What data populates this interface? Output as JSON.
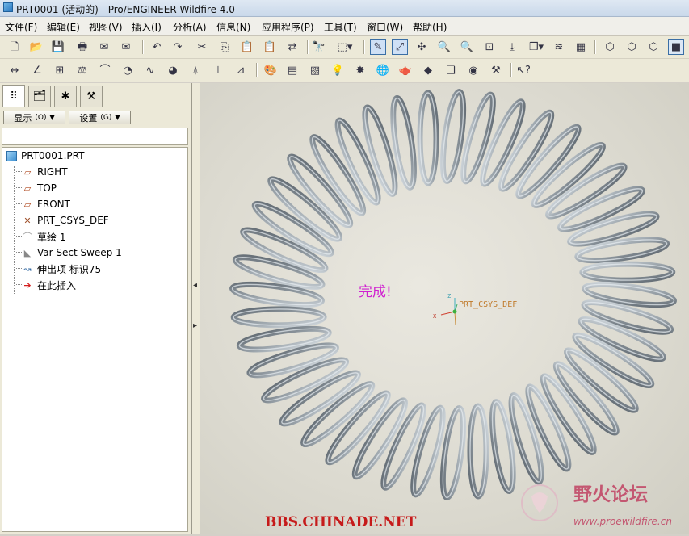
{
  "window": {
    "title": "PRT0001 (活动的) - Pro/ENGINEER Wildfire 4.0"
  },
  "menu": [
    "文件(F)",
    "编辑(E)",
    "视图(V)",
    "插入(I)",
    "分析(A)",
    "信息(N)",
    "应用程序(P)",
    "工具(T)",
    "窗口(W)",
    "帮助(H)"
  ],
  "panel": {
    "show_label": "显示",
    "show_key": "(O)",
    "settings_label": "设置",
    "settings_key": "(G)"
  },
  "tree": [
    {
      "label": "PRT0001.PRT",
      "icon": "part-icon"
    },
    {
      "label": "RIGHT",
      "icon": "datum-plane-icon"
    },
    {
      "label": "TOP",
      "icon": "datum-plane-icon"
    },
    {
      "label": "FRONT",
      "icon": "datum-plane-icon"
    },
    {
      "label": "PRT_CSYS_DEF",
      "icon": "csys-icon"
    },
    {
      "label": "草绘 1",
      "icon": "sketch-icon"
    },
    {
      "label": "Var Sect Sweep 1",
      "icon": "sweep-icon"
    },
    {
      "label": "伸出项 标识75",
      "icon": "protrusion-icon"
    },
    {
      "label": "在此插入",
      "icon": "insert-here-arrow-icon"
    }
  ],
  "viewport": {
    "message": "完成!",
    "csys_label": "PRT_CSYS_DEF",
    "csys_axis_labels": [
      "Z",
      "X"
    ],
    "watermark_left": "BBS.CHINADE.NET",
    "watermark_right_title": "野火论坛",
    "watermark_right_url": "www.proewildfire.cn",
    "coil_count": 44,
    "colors": {
      "spring": "#8a949c",
      "message": "#d020d0",
      "watermark_left": "#c61a1a",
      "watermark_right": "#c24a68"
    }
  }
}
